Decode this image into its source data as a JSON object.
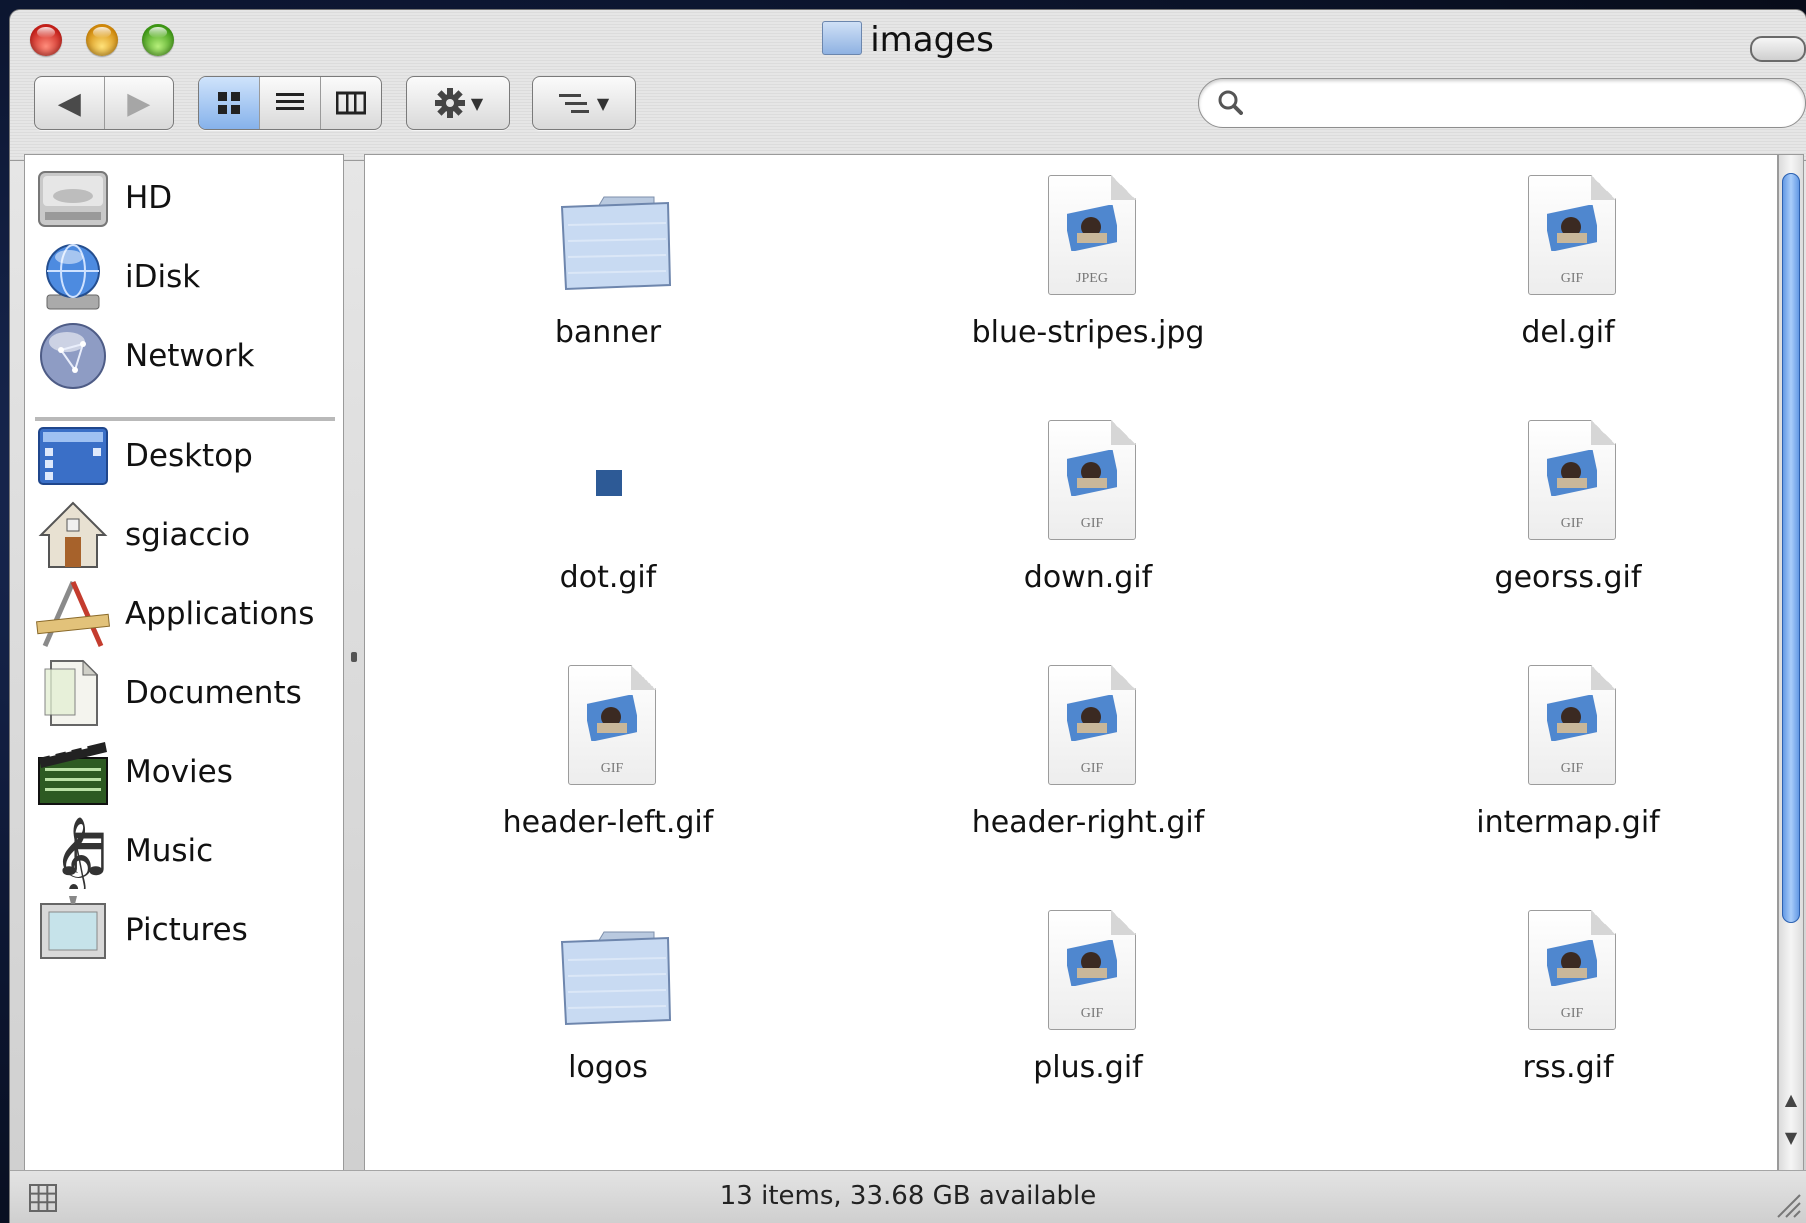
{
  "window": {
    "title": "images"
  },
  "toolbar": {
    "back_icon": "◀",
    "forward_icon": "▶",
    "view_icon_label": "icon-view",
    "view_list_label": "list-view",
    "view_column_label": "column-view",
    "search_placeholder": ""
  },
  "sidebar": {
    "devices": [
      {
        "label": "HD",
        "icon": "hard-drive-icon"
      },
      {
        "label": "iDisk",
        "icon": "idisk-icon"
      },
      {
        "label": "Network",
        "icon": "network-icon"
      }
    ],
    "places": [
      {
        "label": "Desktop",
        "icon": "desktop-icon"
      },
      {
        "label": "sgiaccio",
        "icon": "home-icon"
      },
      {
        "label": "Applications",
        "icon": "applications-icon"
      },
      {
        "label": "Documents",
        "icon": "documents-icon"
      },
      {
        "label": "Movies",
        "icon": "movies-icon"
      },
      {
        "label": "Music",
        "icon": "music-icon"
      },
      {
        "label": "Pictures",
        "icon": "pictures-icon"
      }
    ]
  },
  "files": [
    {
      "name": "banner",
      "kind": "folder"
    },
    {
      "name": "blue-stripes.jpg",
      "kind": "image",
      "ext": "JPEG"
    },
    {
      "name": "del.gif",
      "kind": "image",
      "ext": "GIF"
    },
    {
      "name": "dot.gif",
      "kind": "dot"
    },
    {
      "name": "down.gif",
      "kind": "image",
      "ext": "GIF"
    },
    {
      "name": "georss.gif",
      "kind": "image",
      "ext": "GIF"
    },
    {
      "name": "header-left.gif",
      "kind": "image",
      "ext": "GIF"
    },
    {
      "name": "header-right.gif",
      "kind": "image",
      "ext": "GIF"
    },
    {
      "name": "intermap.gif",
      "kind": "image",
      "ext": "GIF"
    },
    {
      "name": "logos",
      "kind": "folder"
    },
    {
      "name": "plus.gif",
      "kind": "image",
      "ext": "GIF"
    },
    {
      "name": "rss.gif",
      "kind": "image",
      "ext": "GIF"
    }
  ],
  "status": {
    "text": "13 items, 33.68 GB available"
  },
  "colors": {
    "accent": "#5b93e2",
    "dot_file": "#2d5a96"
  }
}
